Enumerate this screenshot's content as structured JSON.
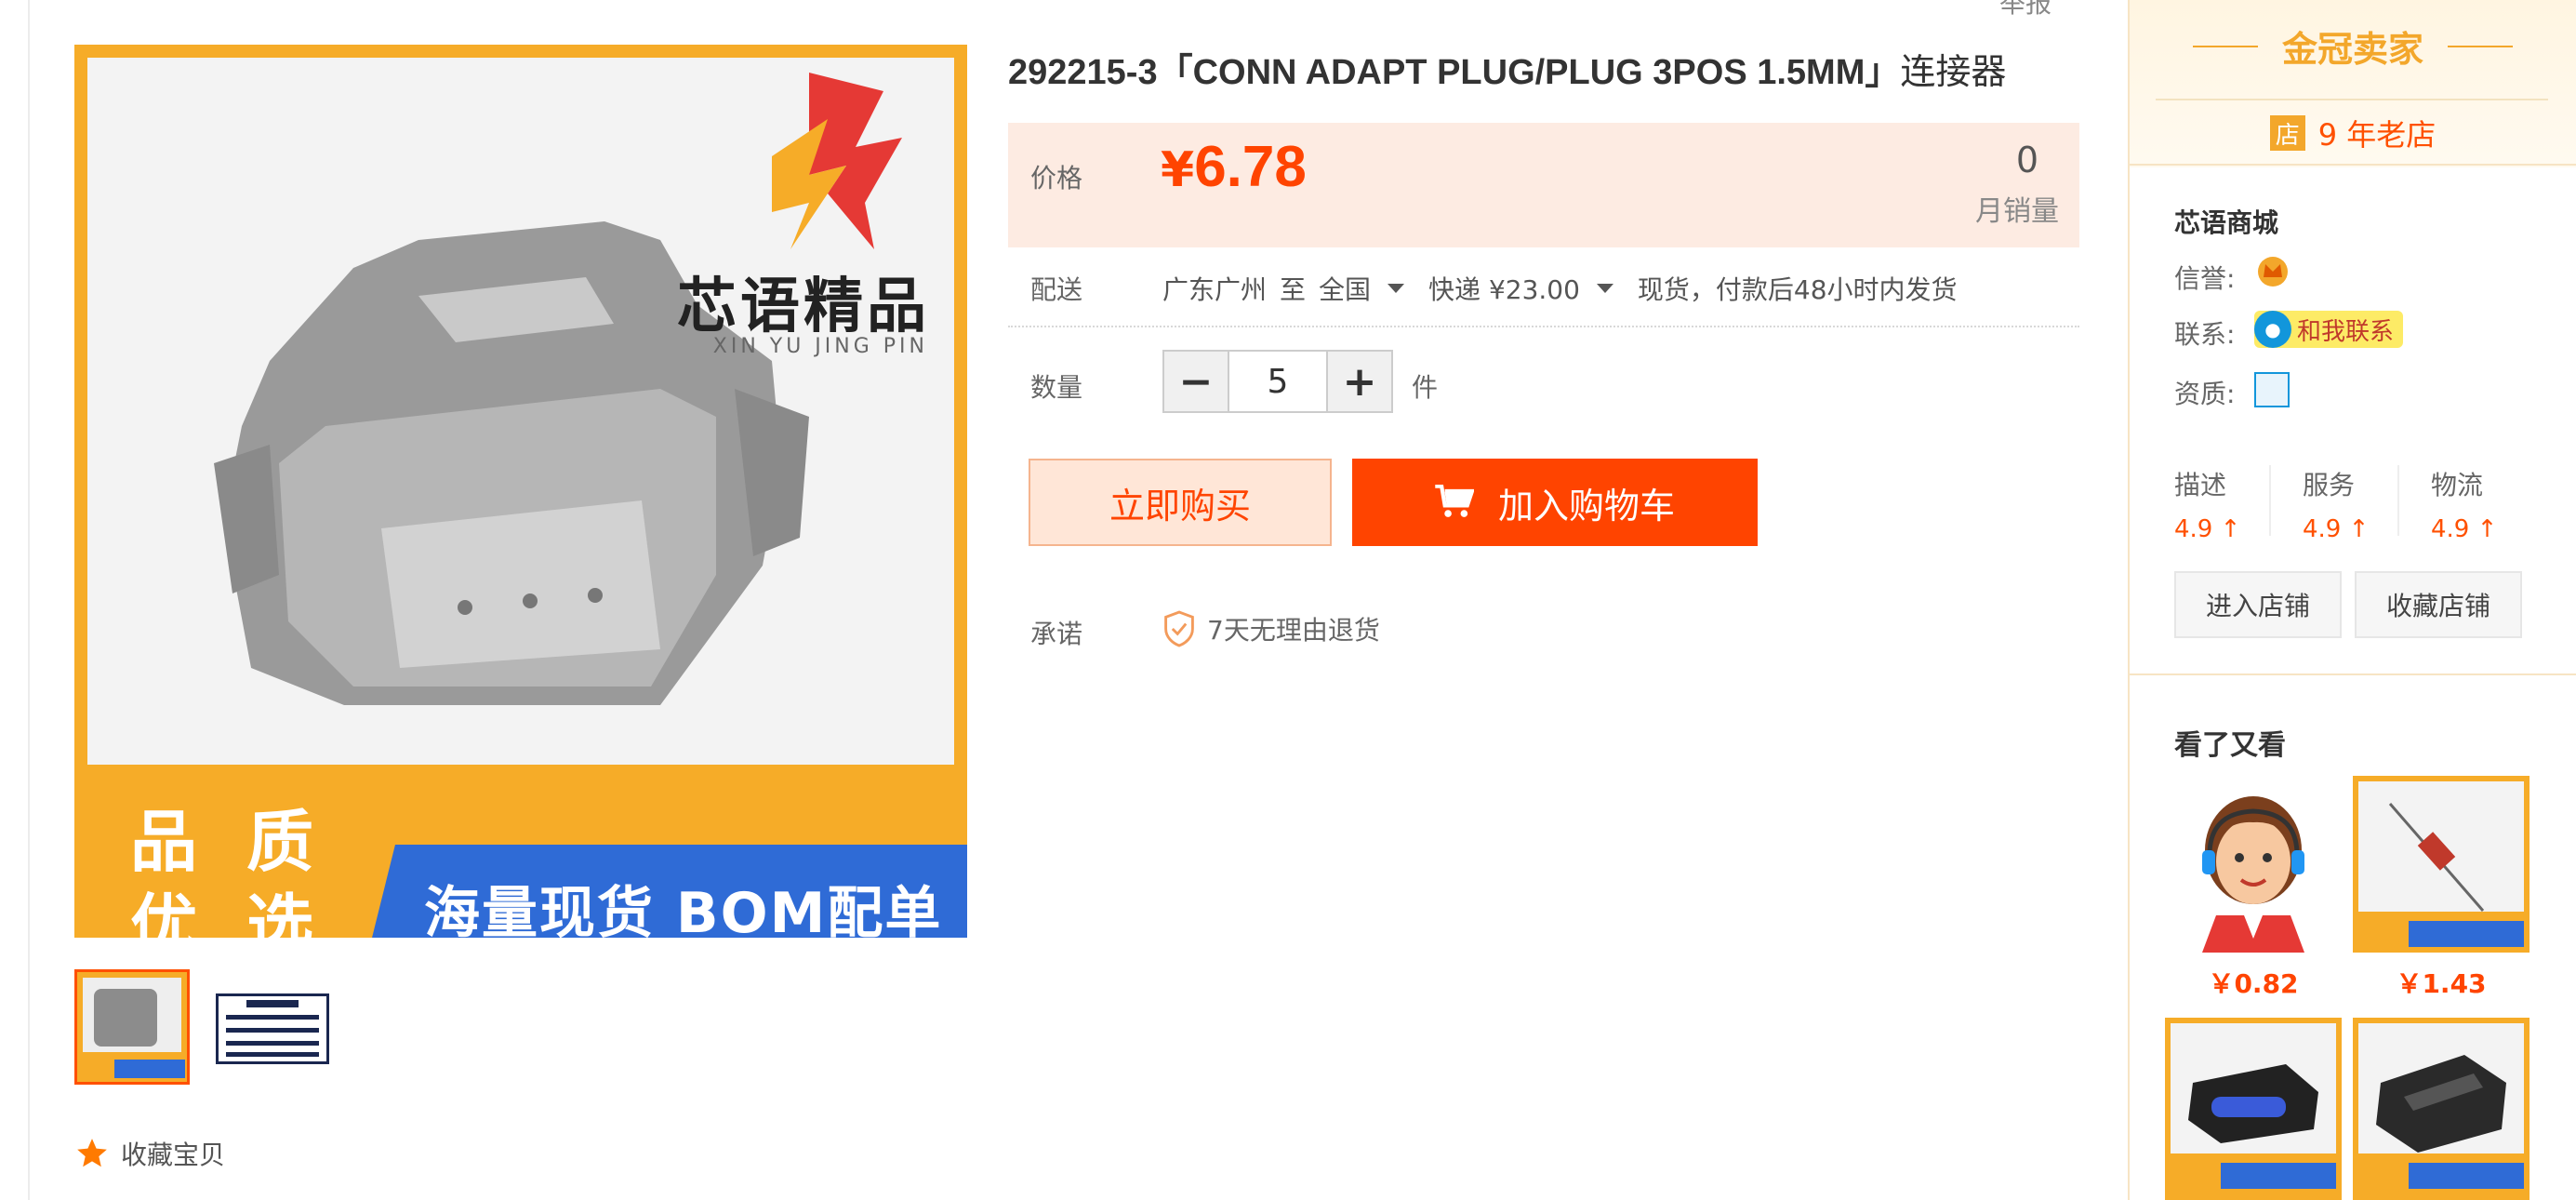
{
  "product": {
    "title_main": "292215-3「CONN ADAPT PLUG/PLUG 3POS 1.5MM」",
    "title_suffix": "连接器",
    "report_label": "举报",
    "main_image": {
      "brand_cn": "芯语精品",
      "brand_en": "XIN YU JING PIN",
      "quality_line1": "品 质",
      "quality_line2": "优 选",
      "banner": "海量现货 BOM配单"
    },
    "favorite_label": "收藏宝贝"
  },
  "price": {
    "label": "价格",
    "currency": "¥",
    "value": "6.78",
    "monthly_sales": "0",
    "monthly_sales_label": "月销量"
  },
  "shipping": {
    "label": "配送",
    "from": "广东广州",
    "to_word": "至",
    "to": "全国",
    "method": "快递 ¥23.00",
    "note": "现货，付款后48小时内发货"
  },
  "quantity": {
    "label": "数量",
    "minus": "−",
    "value": "5",
    "plus": "+",
    "unit": "件"
  },
  "actions": {
    "buy_now": "立即购买",
    "add_to_cart": "加入购物车"
  },
  "promise": {
    "label": "承诺",
    "text": "7天无理由退货"
  },
  "seller": {
    "badge_title": "金冠卖家",
    "age_icon": "店",
    "age_text": "9 年老店",
    "shop_name": "芯语商城",
    "reputation_label": "信誉:",
    "contact_label": "联系:",
    "contact_button": "和我联系",
    "qualification_label": "资质:",
    "ratings": [
      {
        "name": "描述",
        "score": "4.9 ↑"
      },
      {
        "name": "服务",
        "score": "4.9 ↑"
      },
      {
        "name": "物流",
        "score": "4.9 ↑"
      }
    ],
    "enter_shop": "进入店铺",
    "favorite_shop": "收藏店铺"
  },
  "recommendations": {
    "title": "看了又看",
    "items": [
      {
        "price": "￥0.82"
      },
      {
        "price": "￥1.43"
      }
    ]
  },
  "colors": {
    "accent": "#ff4400",
    "gold": "#f3a72b",
    "price_bg": "#fdebe2"
  }
}
